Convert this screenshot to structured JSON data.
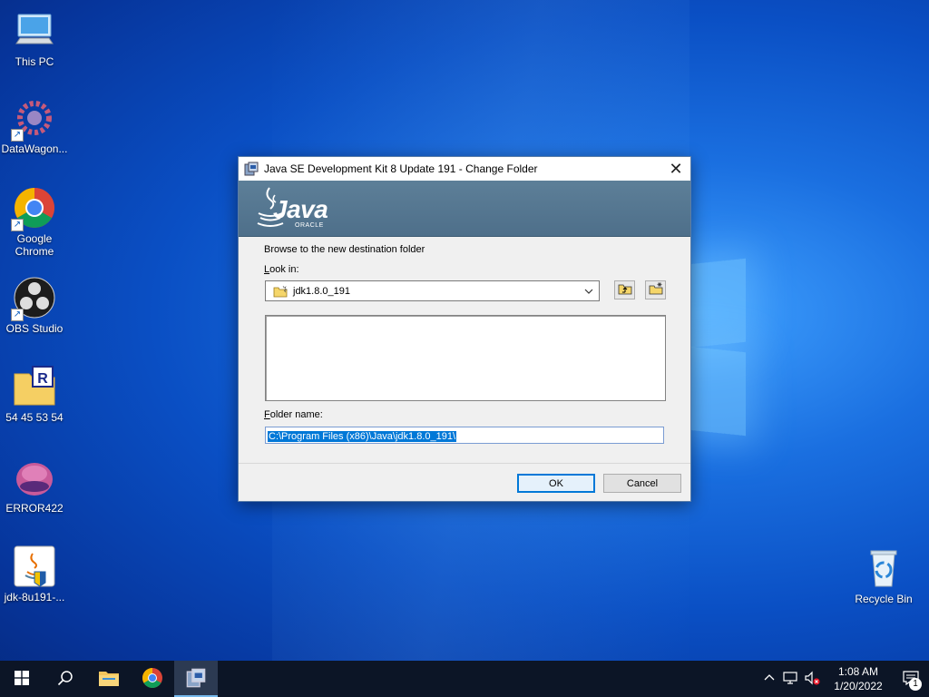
{
  "desktop": {
    "icons": [
      {
        "label": "This PC",
        "icon": "computer-icon"
      },
      {
        "label": "DataWagon...",
        "icon": "datawagon-icon"
      },
      {
        "label": "Google Chrome",
        "icon": "chrome-icon"
      },
      {
        "label": "OBS Studio",
        "icon": "obs-icon"
      },
      {
        "label": "54 45 53 54",
        "icon": "folder-icon"
      },
      {
        "label": "ERROR422",
        "icon": "error422-icon"
      },
      {
        "label": "jdk-8u191-...",
        "icon": "java-installer-icon"
      },
      {
        "label": "Recycle Bin",
        "icon": "recycle-bin-icon"
      }
    ]
  },
  "dialog": {
    "title": "Java SE Development Kit 8 Update 191 - Change Folder",
    "banner_logo": "Java",
    "banner_sub": "ORACLE",
    "browse_text": "Browse to the new destination folder",
    "lookin_label_u": "L",
    "lookin_label_rest": "ook in:",
    "lookin_value": "jdk1.8.0_191",
    "foldername_label_u": "F",
    "foldername_label_rest": "older name:",
    "folder_path": "C:\\Program Files (x86)\\Java\\jdk1.8.0_191\\",
    "ok_label": "OK",
    "cancel_label": "Cancel"
  },
  "taskbar": {
    "clock_time": "1:08 AM",
    "clock_date": "1/20/2022",
    "notification_count": "1"
  },
  "colors": {
    "accent": "#0078d7",
    "taskbar": "#0c1526",
    "banner": "#5d7f98"
  }
}
